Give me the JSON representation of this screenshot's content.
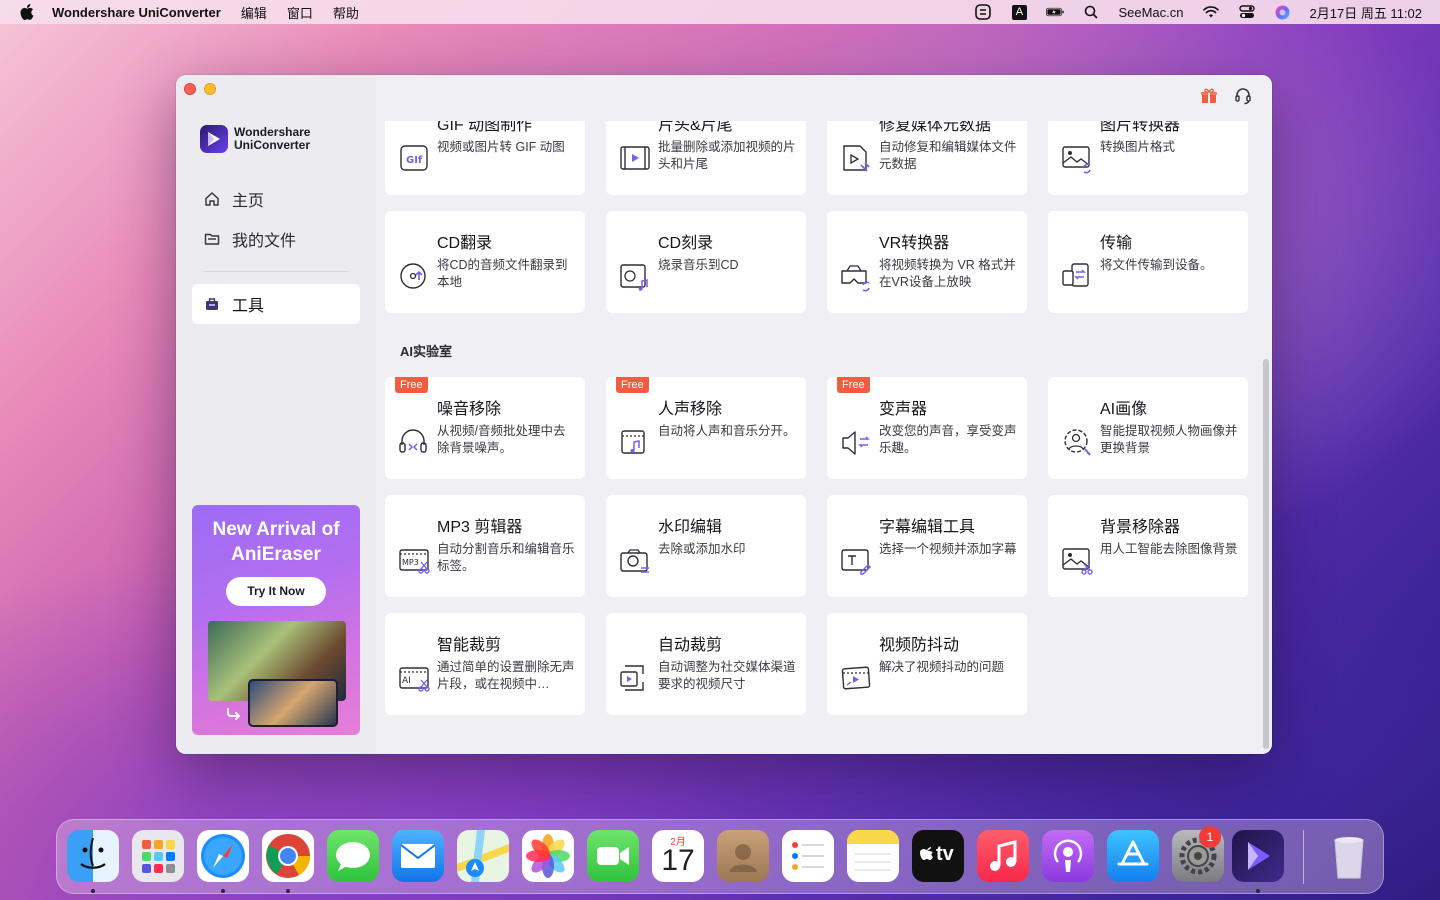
{
  "menubar": {
    "app_name": "Wondershare UniConverter",
    "menus": [
      "编辑",
      "窗口",
      "帮助"
    ],
    "input_badge": "A",
    "site": "SeeMac.cn",
    "clock": "2月17日 周五  11:02"
  },
  "sidebar": {
    "logo_line1": "Wondershare",
    "logo_line2": "UniConverter",
    "nav": [
      {
        "label": "主页",
        "icon": "home-icon"
      },
      {
        "label": "我的文件",
        "icon": "folder-icon"
      },
      {
        "label": "工具",
        "icon": "toolbox-icon",
        "active": true
      }
    ],
    "promo": {
      "title_line1": "New Arrival of",
      "title_line2": "AniEraser",
      "button": "Try It Now"
    }
  },
  "tools_top": [
    {
      "title": "GIF 动图制作",
      "desc": "视频或图片转 GIF 动图",
      "icon": "gif-icon"
    },
    {
      "title": "片头&片尾",
      "desc": "批量删除或添加视频的片头和片尾",
      "icon": "film-strip-icon"
    },
    {
      "title": "修复媒体元数据",
      "desc": "自动修复和编辑媒体文件元数据",
      "icon": "metadata-icon"
    },
    {
      "title": "图片转换器",
      "desc": "转换图片格式",
      "icon": "image-convert-icon"
    },
    {
      "title": "CD翻录",
      "desc": "将CD的音频文件翻录到本地",
      "icon": "cd-rip-icon"
    },
    {
      "title": "CD刻录",
      "desc": "烧录音乐到CD",
      "icon": "cd-burn-icon"
    },
    {
      "title": "VR转换器",
      "desc": "将视频转换为 VR 格式并在VR设备上放映",
      "icon": "vr-icon"
    },
    {
      "title": "传输",
      "desc": "将文件传输到设备。",
      "icon": "transfer-icon"
    }
  ],
  "ai_section": {
    "title": "AI实验室",
    "free_label": "Free",
    "tools": [
      {
        "title": "噪音移除",
        "desc": "从视频/音频批处理中去除背景噪声。",
        "icon": "noise-remove-icon",
        "free": true
      },
      {
        "title": "人声移除",
        "desc": "自动将人声和音乐分开。",
        "icon": "vocal-remove-icon",
        "free": true
      },
      {
        "title": "变声器",
        "desc": "改变您的声音，享受变声乐趣。",
        "icon": "voice-changer-icon",
        "free": true
      },
      {
        "title": "AI画像",
        "desc": "智能提取视频人物画像并更换背景",
        "icon": "ai-portrait-icon",
        "free": false
      },
      {
        "title": "MP3 剪辑器",
        "desc": "自动分割音乐和编辑音乐标签。",
        "icon": "mp3-cutter-icon",
        "free": false
      },
      {
        "title": "水印编辑",
        "desc": "去除或添加水印",
        "icon": "watermark-icon",
        "free": false
      },
      {
        "title": "字幕编辑工具",
        "desc": "选择一个视频并添加字幕",
        "icon": "subtitle-icon",
        "free": false
      },
      {
        "title": "背景移除器",
        "desc": "用人工智能去除图像背景",
        "icon": "bg-remove-icon",
        "free": false
      },
      {
        "title": "智能裁剪",
        "desc": "通过简单的设置删除无声片段，或在视频中…",
        "icon": "smart-trim-icon",
        "free": false
      },
      {
        "title": "自动裁剪",
        "desc": "自动调整为社交媒体渠道要求的视频尺寸",
        "icon": "auto-crop-icon",
        "free": false
      },
      {
        "title": "视频防抖动",
        "desc": "解决了视频抖动的问题",
        "icon": "stabilize-icon",
        "free": false
      }
    ]
  },
  "dock": {
    "apps": [
      "finder-icon",
      "launchpad-icon",
      "safari-icon",
      "chrome-icon",
      "messages-icon",
      "mail-icon",
      "maps-icon",
      "photos-icon",
      "facetime-icon",
      "calendar-icon",
      "contacts-icon",
      "reminders-icon",
      "notes-icon",
      "tv-icon",
      "music-icon",
      "podcasts-icon",
      "appstore-icon",
      "settings-icon",
      "uniconverter-icon",
      "trash-icon"
    ],
    "calendar_month": "2月",
    "calendar_day": "17",
    "tv_label": "tv",
    "settings_badge": "1"
  },
  "colors": {
    "accent": "#6b3ff0",
    "free_badge": "#f25c41",
    "icon_accent": "#7b5cf0"
  }
}
